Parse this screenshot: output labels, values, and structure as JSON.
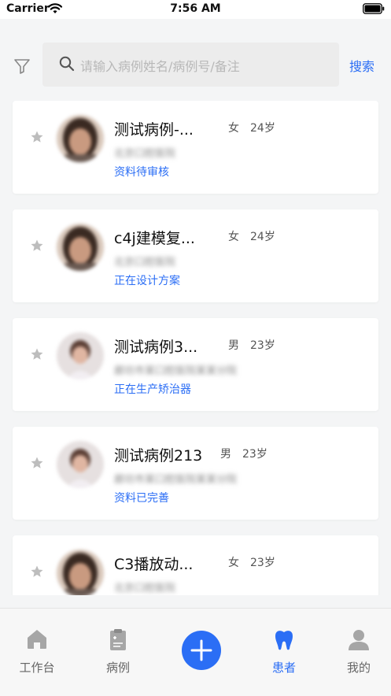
{
  "status_bar": {
    "carrier": "Carrier",
    "time": "7:56 AM"
  },
  "search": {
    "placeholder": "请输入病例姓名/病例号/备注",
    "button_label": "搜索"
  },
  "patients": [
    {
      "name": "测试病例-...",
      "gender": "女",
      "age": "24岁",
      "hospital": "北京口腔医院",
      "status": "资料待审核",
      "starred": false
    },
    {
      "name": "c4j建模复...",
      "gender": "女",
      "age": "24岁",
      "hospital": "北京口腔医院",
      "status": "正在设计方案",
      "starred": false
    },
    {
      "name": "测试病例3...",
      "gender": "男",
      "age": "23岁",
      "hospital": "廊坊市某口腔医院某某分院",
      "status": "正在生产矫治器",
      "starred": false
    },
    {
      "name": "测试病例213",
      "gender": "男",
      "age": "23岁",
      "hospital": "廊坊市某口腔医院某某分院",
      "status": "资料已完善",
      "starred": false
    },
    {
      "name": "C3播放动...",
      "gender": "女",
      "age": "23岁",
      "hospital": "北京口腔医院",
      "status": "",
      "starred": false
    }
  ],
  "tabbar": {
    "items": [
      {
        "label": "工作台",
        "icon": "home-icon"
      },
      {
        "label": "病例",
        "icon": "clipboard-icon"
      },
      {
        "label": "",
        "icon": "plus-icon"
      },
      {
        "label": "患者",
        "icon": "tooth-icon"
      },
      {
        "label": "我的",
        "icon": "person-icon"
      }
    ],
    "active": "患者"
  },
  "colors": {
    "accent": "#2b6ef5",
    "background": "#f4f5f6",
    "card": "#ffffff"
  }
}
